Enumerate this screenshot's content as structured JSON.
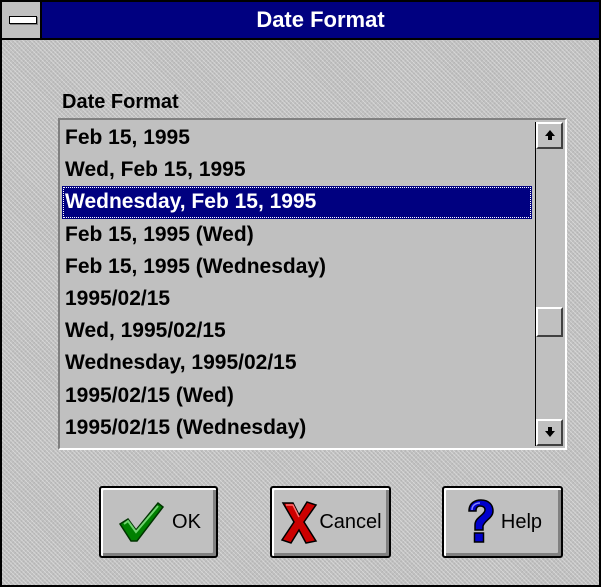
{
  "window": {
    "title": "Date Format"
  },
  "group": {
    "label": "Date Format"
  },
  "list": {
    "items": [
      "Feb 15, 1995",
      "Wed, Feb 15, 1995",
      "Wednesday, Feb 15, 1995",
      "Feb 15, 1995 (Wed)",
      "Feb 15, 1995 (Wednesday)",
      "1995/02/15",
      "Wed, 1995/02/15",
      "Wednesday, 1995/02/15",
      "1995/02/15 (Wed)",
      "1995/02/15 (Wednesday)"
    ],
    "selected_index": 2
  },
  "buttons": {
    "ok_label": "OK",
    "cancel_label": "Cancel",
    "help_label": "Help"
  },
  "icons": {
    "system_menu": "system-menu-icon",
    "scroll_up": "arrow-up-icon",
    "scroll_down": "arrow-down-icon",
    "ok": "checkmark-icon",
    "cancel": "red-x-icon",
    "help": "question-mark-icon"
  },
  "colors": {
    "titlebar": "#000080",
    "selection": "#000080",
    "face": "#c0c0c0",
    "checkmark": "#008000",
    "cancel_x": "#cc0000",
    "help": "#0000cc"
  }
}
